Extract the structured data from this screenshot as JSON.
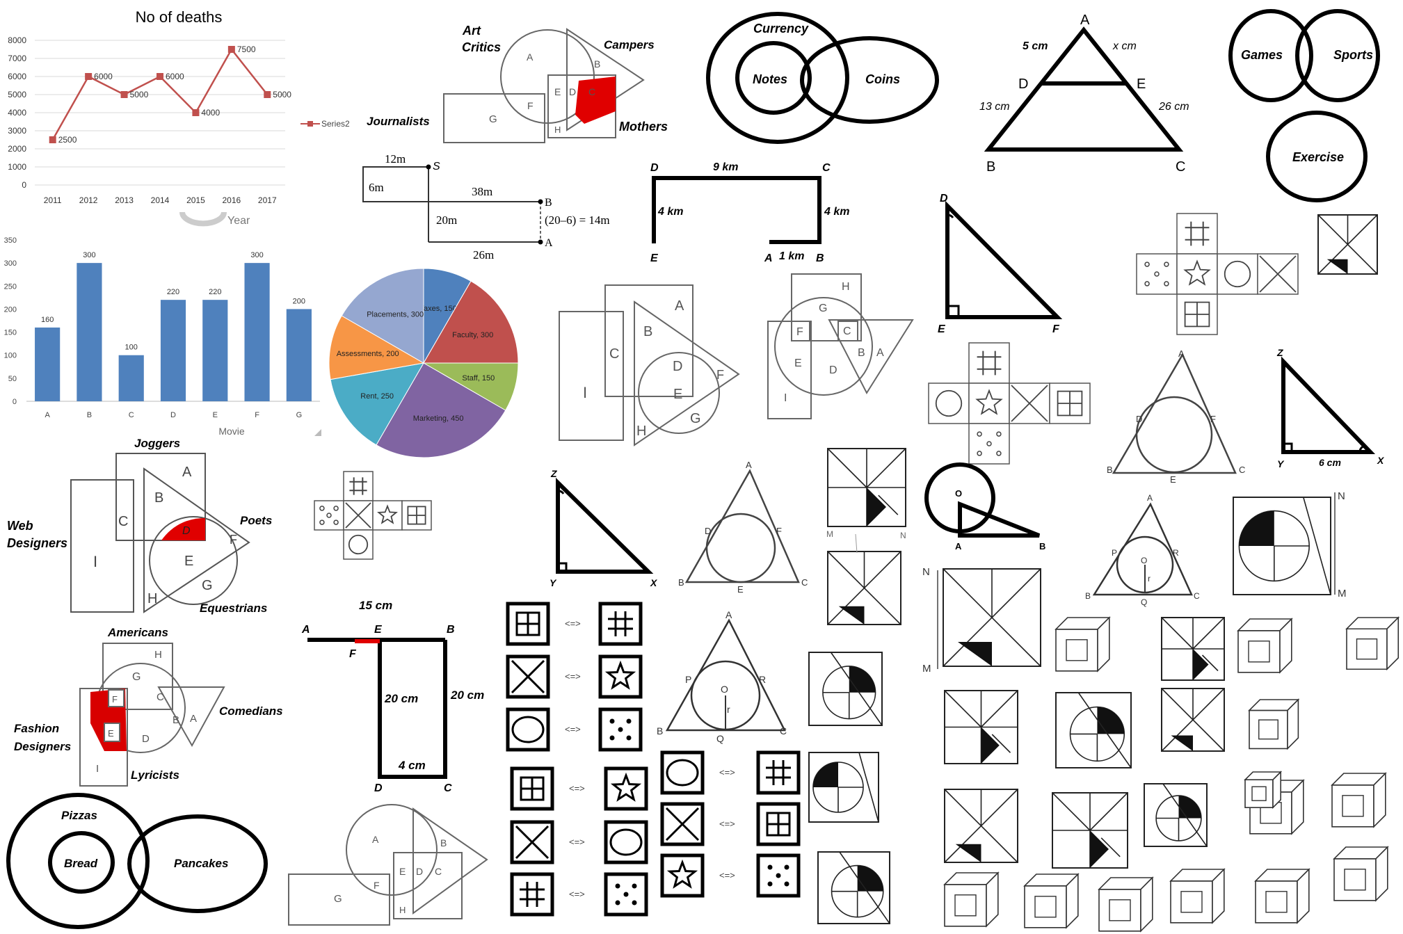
{
  "line_chart": {
    "title": "No of deaths",
    "xlabel": "Year",
    "series_name": "Series2",
    "categories": [
      "2011",
      "2012",
      "2013",
      "2014",
      "2015",
      "2016",
      "2017"
    ],
    "values": [
      2500,
      6000,
      5000,
      6000,
      4000,
      7500,
      5000
    ],
    "yticks": [
      "8000",
      "7000",
      "6000",
      "5000",
      "4000",
      "3000",
      "2000",
      "1000",
      "0"
    ],
    "color": "#c0504d"
  },
  "bar_chart": {
    "xlabel": "Movie",
    "categories": [
      "A",
      "B",
      "C",
      "D",
      "E",
      "F",
      "G"
    ],
    "values": [
      160,
      300,
      100,
      220,
      220,
      300,
      200
    ],
    "yticks": [
      "350",
      "300",
      "250",
      "200",
      "150",
      "100",
      "50",
      "0"
    ],
    "color": "#4f81bd"
  },
  "pie_chart": {
    "slices": [
      {
        "label": "Taxes, 150",
        "value": 150,
        "color": "#4f81bd"
      },
      {
        "label": "Faculty, 300",
        "value": 300,
        "color": "#c0504d"
      },
      {
        "label": "Staff, 150",
        "value": 150,
        "color": "#9bbb59"
      },
      {
        "label": "Marketing, 450",
        "value": 450,
        "color": "#8064a2"
      },
      {
        "label": "Rent, 250",
        "value": 250,
        "color": "#4bacc6"
      },
      {
        "label": "Assessments, 200",
        "value": 200,
        "color": "#f79646"
      },
      {
        "label": "Placements, 300",
        "value": 300,
        "color": "#95a7d0"
      }
    ]
  },
  "chart_data": [
    {
      "type": "line",
      "title": "No of deaths",
      "xlabel": "Year",
      "categories": [
        "2011",
        "2012",
        "2013",
        "2014",
        "2015",
        "2016",
        "2017"
      ],
      "series": [
        {
          "name": "Series2",
          "values": [
            2500,
            6000,
            5000,
            6000,
            4000,
            7500,
            5000
          ]
        }
      ],
      "ylim": [
        0,
        8000
      ]
    },
    {
      "type": "bar",
      "xlabel": "Movie",
      "categories": [
        "A",
        "B",
        "C",
        "D",
        "E",
        "F",
        "G"
      ],
      "values": [
        160,
        300,
        100,
        220,
        220,
        300,
        200
      ],
      "ylim": [
        0,
        350
      ]
    },
    {
      "type": "pie",
      "categories": [
        "Taxes",
        "Faculty",
        "Staff",
        "Marketing",
        "Rent",
        "Assessments",
        "Placements"
      ],
      "values": [
        150,
        300,
        150,
        450,
        250,
        200,
        300
      ]
    }
  ],
  "venn_art": {
    "art": "Art",
    "critics": "Critics",
    "campers": "Campers",
    "journalists": "Journalists",
    "mothers": "Mothers",
    "a": "A",
    "b": "B",
    "g": "G",
    "f": "F",
    "e": "E",
    "d": "D",
    "c": "C",
    "h": "H"
  },
  "venn_currency": {
    "currency": "Currency",
    "notes": "Notes",
    "coins": "Coins"
  },
  "triangle_abc": {
    "a": "A",
    "b": "B",
    "c": "C",
    "d": "D",
    "e": "E",
    "ad": "5 cm",
    "ae": "x cm",
    "db": "13 cm",
    "ec": "26 cm"
  },
  "venn_games": {
    "games": "Games",
    "sports": "Sports",
    "exercise": "Exercise"
  },
  "path_dist": {
    "s": "S",
    "b": "B",
    "a": "A",
    "d12": "12m",
    "d6": "6m",
    "d38": "38m",
    "d20": "20m",
    "d26": "26m",
    "calc": "(20–6) = 14m"
  },
  "route_km": {
    "d": "D",
    "c": "C",
    "e": "E",
    "a": "A",
    "b": "B",
    "top": "9 km",
    "left": "4 km",
    "right": "4 km",
    "ab": "1 km"
  },
  "joggers": {
    "joggers": "Joggers",
    "web": "Web",
    "designers": "Designers",
    "poets": "Poets",
    "equestrians": "Equestrians",
    "i": "I",
    "c": "C",
    "b": "B",
    "a": "A",
    "d": "D",
    "e": "E",
    "f": "F",
    "g": "G",
    "h": "H"
  },
  "americans": {
    "americans": "Americans",
    "comedians": "Comedians",
    "fashion": "Fashion",
    "designers": "Designers",
    "lyricists": "Lyricists",
    "h": "H",
    "g": "G",
    "c": "C",
    "b": "B",
    "a": "A",
    "d": "D",
    "i": "I",
    "f": "F",
    "e": "E"
  },
  "pizzas": {
    "pizzas": "Pizzas",
    "bread": "Bread",
    "pancakes": "Pancakes"
  },
  "rect_cm": {
    "a": "A",
    "e": "E",
    "b": "B",
    "f": "F",
    "d": "D",
    "c": "C",
    "top": "15 cm",
    "inner": "20 cm",
    "right": "20 cm",
    "bottom": "4 cm"
  },
  "tri_dfe": {
    "d": "D",
    "e": "E",
    "f": "F"
  },
  "tri_zyx": {
    "z": "Z",
    "y": "Y",
    "x": "X",
    "yx": "6 cm"
  },
  "tri_zyx2": {
    "z": "Z",
    "y": "Y",
    "x": "X"
  },
  "circle_oab": {
    "o": "O",
    "a": "A",
    "b": "B"
  },
  "incircle1": {
    "a": "A",
    "b": "B",
    "c": "C",
    "d": "D",
    "e": "E",
    "f": "F"
  },
  "incircle2": {
    "a": "A",
    "b": "B",
    "c": "C",
    "d": "D",
    "e": "E",
    "f": "F"
  },
  "incircle3": {
    "a": "A",
    "b": "B",
    "c": "C",
    "p": "P",
    "r": "R",
    "q": "Q",
    "o": "O",
    "rr": "r"
  },
  "incircle4": {
    "a": "A",
    "b": "B",
    "c": "C",
    "p": "P",
    "r": "R",
    "q": "Q",
    "o": "O",
    "rr": "r"
  },
  "pair_symbol": "<=>",
  "mn": {
    "m": "M",
    "n": "N"
  }
}
